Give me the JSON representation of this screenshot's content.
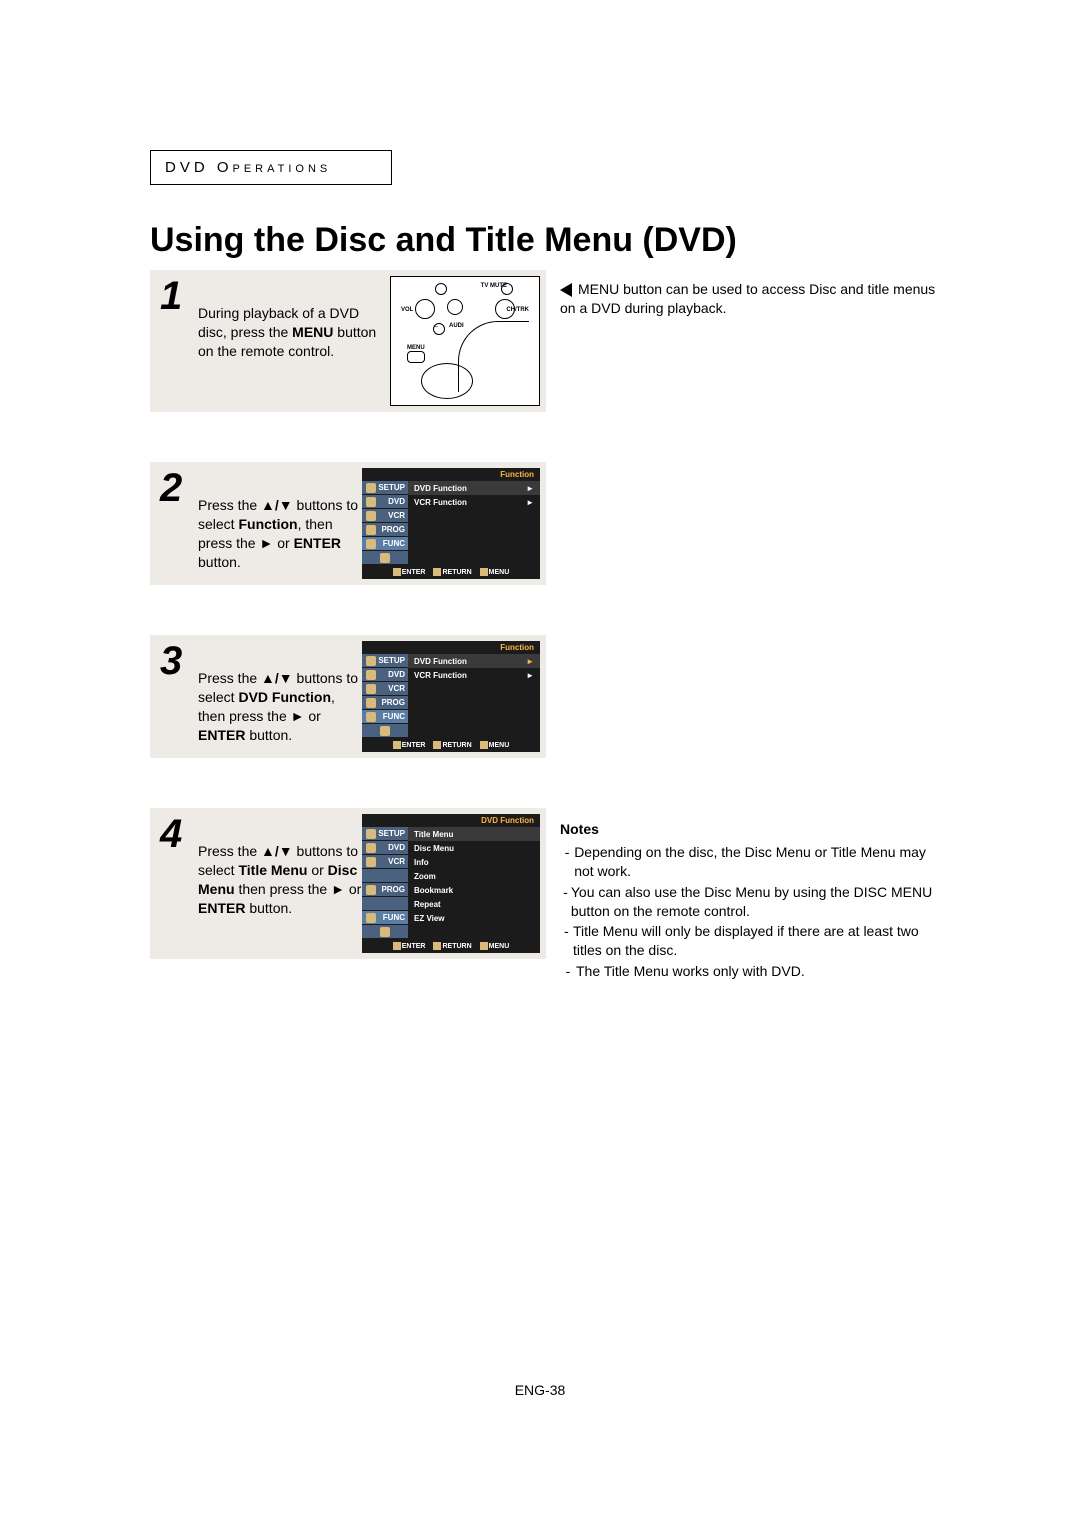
{
  "section_label": "DVD Operations",
  "title": "Using the Disc and Title Menu (DVD)",
  "callout_text": "MENU button can be used to access Disc and title menus on a DVD during playback.",
  "steps": [
    {
      "num": "1",
      "text_before": "During playback of a DVD disc, press the ",
      "bold1": "MENU",
      "text_after": " button on the remote control."
    },
    {
      "num": "2",
      "text_before": "Press the ",
      "arrows": "▲/▼",
      "text_mid1": " buttons to select ",
      "bold1": "Function",
      "text_mid2": ", then press the ",
      "right_arrow": "►",
      "text_mid3": " or ",
      "bold2": "ENTER",
      "text_after": " button."
    },
    {
      "num": "3",
      "text_before": "Press the ",
      "arrows": "▲/▼",
      "text_mid1": " buttons to select ",
      "bold1": "DVD Function",
      "text_mid2": ", then press the ",
      "right_arrow": "►",
      "text_mid3": " or ",
      "bold2": "ENTER",
      "text_after": " button."
    },
    {
      "num": "4",
      "text_before": "Press the ",
      "arrows": "▲/▼",
      "text_mid1": " buttons to select ",
      "bold1": "Title Menu",
      "text_mid2": " or ",
      "bold2": "Disc Menu",
      "text_mid3": " then press the ",
      "right_arrow": "►",
      "text_mid4": " or ",
      "bold3": "ENTER",
      "text_after": " button."
    }
  ],
  "menu_common": {
    "head_function": "Function",
    "head_dvd_function": "DVD Function",
    "left_items": [
      "SETUP",
      "DVD",
      "VCR",
      "PROG",
      "FUNC"
    ],
    "func_rows": [
      "DVD Function",
      "VCR Function"
    ],
    "dvd_rows": [
      "Title Menu",
      "Disc Menu",
      "Info",
      "Zoom",
      "Bookmark",
      "Repeat",
      "EZ View"
    ],
    "bottom": {
      "enter": "ENTER",
      "return": "RETURN",
      "menu": "MENU"
    }
  },
  "notes_head": "Notes",
  "notes": [
    "Depending on the disc, the Disc Menu or Title Menu may not work.",
    "You can also use the Disc Menu by using the DISC MENU button on the remote control.",
    "Title Menu will only be displayed if there are at least two titles on the disc.",
    "The Title Menu works only with DVD."
  ],
  "page_number": "ENG-38",
  "remote_labels": {
    "tv_mute": "TV MUTE",
    "vol": "VOL",
    "chtrk": "CH/TRK",
    "aud": "AUDI",
    "menu": "MENU"
  }
}
